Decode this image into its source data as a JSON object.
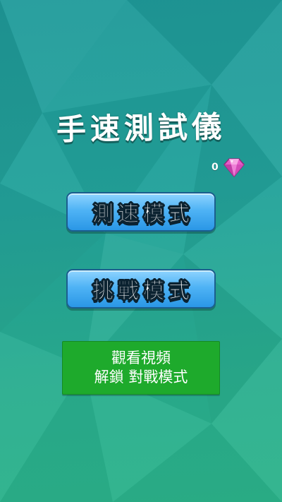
{
  "title": "手速測試儀",
  "gem_counter": {
    "count": "0",
    "icon": "pink-gem-icon",
    "gem_color": "#e75bc7"
  },
  "buttons": {
    "speed_mode": "測速模式",
    "challenge_mode": "挑戰模式",
    "unlock": {
      "line1": "觀看視頻",
      "line2": "解鎖 對戰模式"
    }
  },
  "colors": {
    "background_top": "#1f9a9a",
    "background_bottom": "#2bb28a",
    "mode_button": "#4fb3f5",
    "unlock_button": "#1eaa2c"
  }
}
